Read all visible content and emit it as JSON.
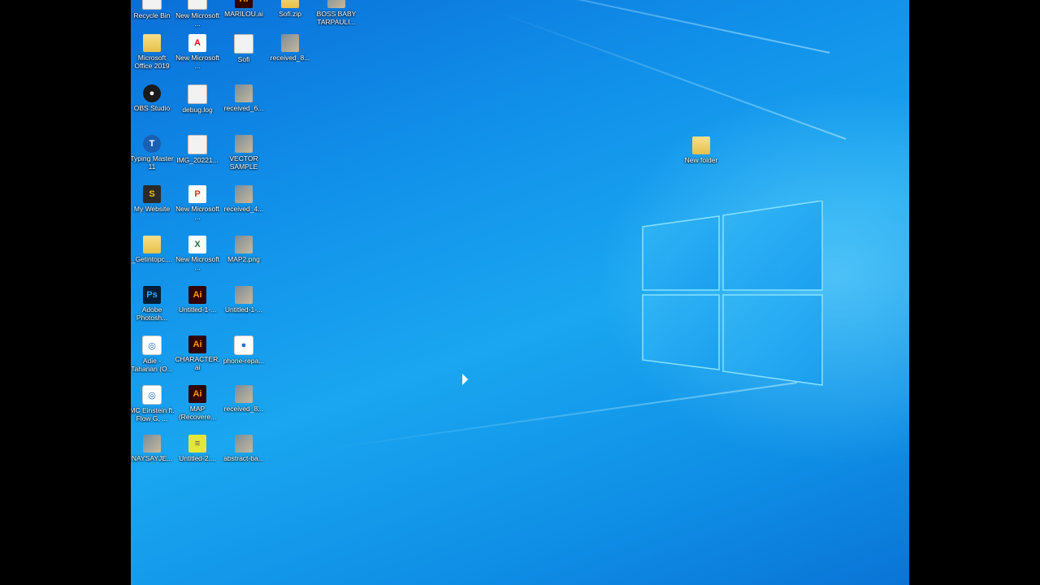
{
  "desktop": {
    "icons": [
      {
        "label": "Recycle Bin",
        "type": "doc",
        "glyph": ""
      },
      {
        "label": "New Microsoft ...",
        "type": "doc",
        "glyph": ""
      },
      {
        "label": "MARILOU.ai",
        "type": "ai",
        "glyph": "Ai"
      },
      {
        "label": "Sofi.zip",
        "type": "folder",
        "glyph": ""
      },
      {
        "label": "BOSS BABY TARPAULI...",
        "type": "img",
        "glyph": ""
      },
      {
        "label": "Microsoft Office 2019",
        "type": "folder",
        "glyph": ""
      },
      {
        "label": "New Microsoft ...",
        "type": "pdf",
        "glyph": "A"
      },
      {
        "label": "Sofi",
        "type": "doc",
        "glyph": ""
      },
      {
        "label": "received_8...",
        "type": "img",
        "glyph": ""
      },
      {
        "label": "OBS Studio",
        "type": "obs",
        "glyph": "●"
      },
      {
        "label": "debug.log",
        "type": "doc",
        "glyph": ""
      },
      {
        "label": "received_6...",
        "type": "img",
        "glyph": ""
      },
      {
        "label": "Typing Master 11",
        "type": "typ",
        "glyph": "T"
      },
      {
        "label": "IMG_20221...",
        "type": "doc",
        "glyph": ""
      },
      {
        "label": "VECTOR SAMPLE",
        "type": "img",
        "glyph": ""
      },
      {
        "label": "My Website",
        "type": "web",
        "glyph": "S"
      },
      {
        "label": "New Microsoft ...",
        "type": "ppt",
        "glyph": "P"
      },
      {
        "label": "received_4...",
        "type": "img",
        "glyph": ""
      },
      {
        "label": "_Getintopc....",
        "type": "folder",
        "glyph": ""
      },
      {
        "label": "New Microsoft ...",
        "type": "xls",
        "glyph": "X"
      },
      {
        "label": "MAP2.png",
        "type": "img",
        "glyph": ""
      },
      {
        "label": "Adobe Photosh...",
        "type": "ps",
        "glyph": "Ps"
      },
      {
        "label": "Untitled-1-...",
        "type": "ai",
        "glyph": "Ai"
      },
      {
        "label": "Untitled-1-...",
        "type": "img",
        "glyph": ""
      },
      {
        "label": "Adie - Tahanan (O...",
        "type": "circ",
        "glyph": "◎"
      },
      {
        "label": "CHARACTER.ai",
        "type": "ai",
        "glyph": "Ai"
      },
      {
        "label": "phone-repa...",
        "type": "circ",
        "glyph": "●"
      },
      {
        "label": "MC Einstein ft. Flow G, ...",
        "type": "circ",
        "glyph": "◎"
      },
      {
        "label": "MAP (Recovere...",
        "type": "ai",
        "glyph": "Ai"
      },
      {
        "label": "received_8...",
        "type": "img",
        "glyph": ""
      },
      {
        "label": "NAYSAYJE...",
        "type": "img",
        "glyph": ""
      },
      {
        "label": "Untitled-2....",
        "type": "yellow",
        "glyph": "≡"
      },
      {
        "label": "abstract-ba...",
        "type": "img",
        "glyph": ""
      }
    ],
    "new_folder": {
      "label": "New folder",
      "type": "folder",
      "glyph": ""
    }
  },
  "colors": {
    "wallpaper_accent": "#1aa6f0",
    "logo_glow": "#7fe0ff"
  }
}
